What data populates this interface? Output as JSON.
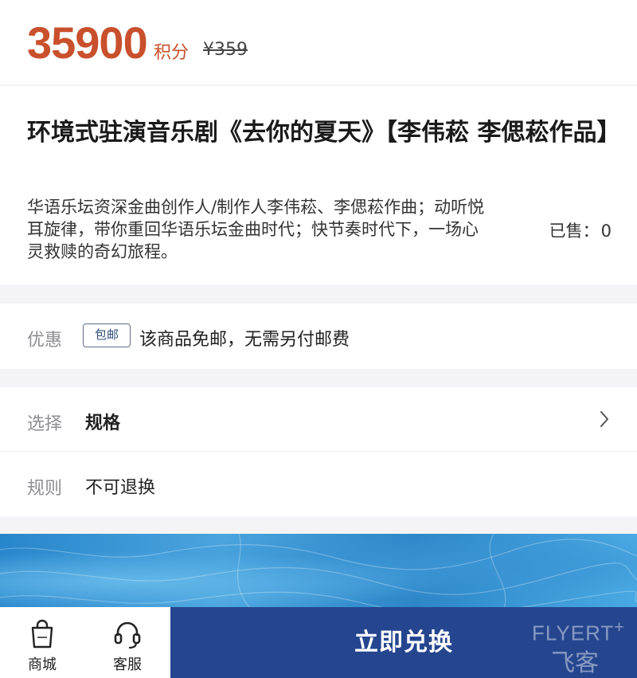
{
  "price": {
    "points": "35900",
    "unit": "积分",
    "original": "¥359"
  },
  "product": {
    "title": "环境式驻演音乐剧《去你的夏天》【李伟菘 李偲菘作品】",
    "description": "华语乐坛资深金曲创作人/制作人李伟菘、李偲菘作曲；动听悦耳旋律，带你重回华语乐坛金曲时代；快节奏时代下，一场心灵救赎的奇幻旅程。",
    "sold_label": "已售：",
    "sold_count": "0"
  },
  "promo": {
    "label": "优惠",
    "tag": "包邮",
    "text": "该商品免邮，无需另付邮费"
  },
  "spec": {
    "label": "选择",
    "value": "规格"
  },
  "rules": {
    "label": "规则",
    "value": "不可退换"
  },
  "bottom": {
    "shop_label": "商城",
    "service_label": "客服",
    "redeem_label": "立即兑换"
  },
  "watermark": {
    "line1": "FLYERT",
    "plus": "+",
    "line2": "飞客"
  },
  "icons": {
    "shop": "shopping-bag-icon",
    "service": "headset-icon",
    "chevron": "chevron-right-icon"
  },
  "colors": {
    "price": "#c9502c",
    "redeem_bg": "#25468f",
    "tag_border": "#5f6f86"
  }
}
